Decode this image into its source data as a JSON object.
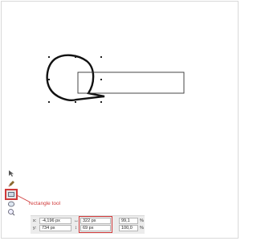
{
  "annotation": {
    "label": "rectangle tool",
    "color": "#d03a3a"
  },
  "toolbox": {
    "tools": [
      {
        "icon": "pointer-tool-icon"
      },
      {
        "icon": "pen-tool-icon"
      },
      {
        "icon": "rectangle-tool-icon",
        "selected": true
      },
      {
        "icon": "ellipse-tool-icon"
      },
      {
        "icon": "zoom-tool-icon"
      }
    ]
  },
  "properties": {
    "x_label": "x:",
    "y_label": "y:",
    "x_value": "-4,196 px",
    "y_value": "734 px",
    "width_value": "322 px",
    "height_value": "69 px",
    "scale_x": "99,1",
    "scale_y": "100,0",
    "percent_label": "%"
  }
}
